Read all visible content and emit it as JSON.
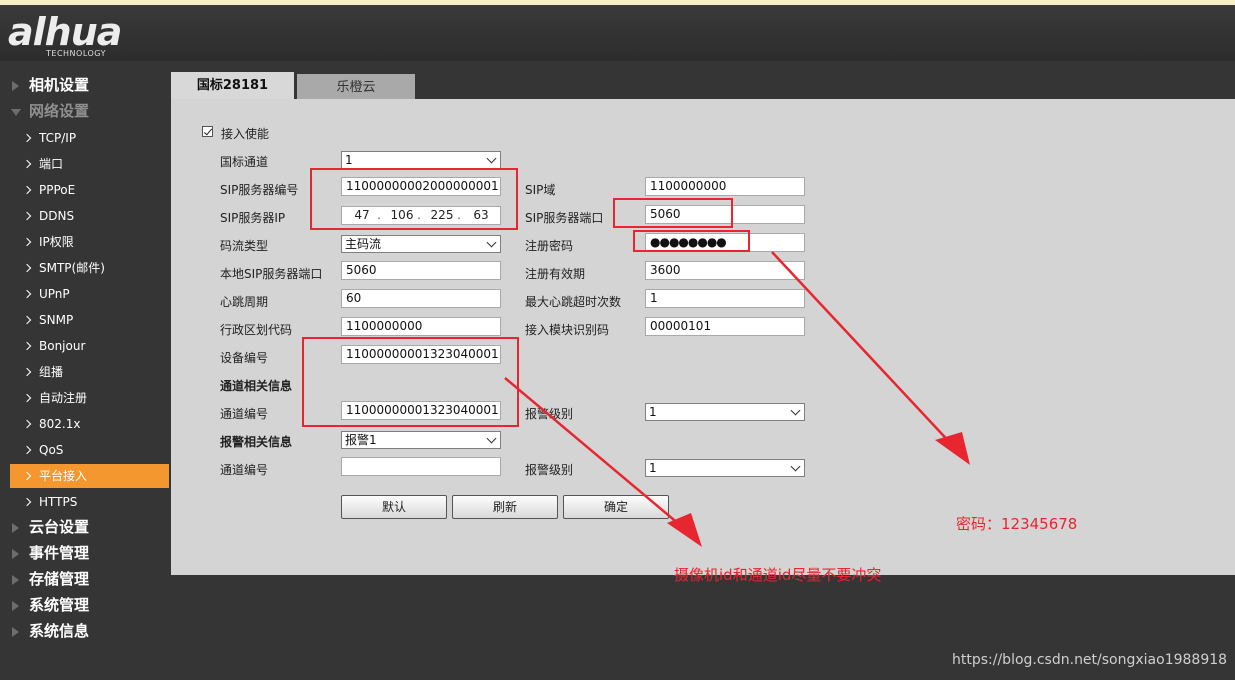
{
  "brand": {
    "logo_text": "alhua",
    "logo_sub": "TECHNOLOGY"
  },
  "sidebar": {
    "top_items": [
      {
        "label": "相机设置"
      },
      {
        "label": "网络设置"
      },
      {
        "label": "云台设置"
      },
      {
        "label": "事件管理"
      },
      {
        "label": "存储管理"
      },
      {
        "label": "系统管理"
      },
      {
        "label": "系统信息"
      }
    ],
    "sub_items": [
      {
        "label": "TCP/IP"
      },
      {
        "label": "端口"
      },
      {
        "label": "PPPoE"
      },
      {
        "label": "DDNS"
      },
      {
        "label": "IP权限"
      },
      {
        "label": "SMTP(邮件)"
      },
      {
        "label": "UPnP"
      },
      {
        "label": "SNMP"
      },
      {
        "label": "Bonjour"
      },
      {
        "label": "组播"
      },
      {
        "label": "自动注册"
      },
      {
        "label": "802.1x"
      },
      {
        "label": "QoS"
      },
      {
        "label": "平台接入"
      },
      {
        "label": "HTTPS"
      }
    ],
    "active_item": "平台接入"
  },
  "tabs": [
    {
      "label": "国标28181"
    },
    {
      "label": "乐橙云"
    }
  ],
  "form": {
    "enable_label": "接入使能",
    "enable_checked": true,
    "gb_channel": {
      "label": "国标通道",
      "value": "1"
    },
    "sip_server_id": {
      "label": "SIP服务器编号",
      "value": "11000000002000000001"
    },
    "sip_domain": {
      "label": "SIP域",
      "value": "1100000000"
    },
    "sip_server_ip": {
      "label": "SIP服务器IP",
      "octets": [
        "47",
        "106",
        "225",
        "63"
      ]
    },
    "sip_server_port": {
      "label": "SIP服务器端口",
      "value": "5060"
    },
    "stream_type": {
      "label": "码流类型",
      "value": "主码流"
    },
    "reg_password": {
      "label": "注册密码",
      "value": "●●●●●●●●"
    },
    "local_sip_port": {
      "label": "本地SIP服务器端口",
      "value": "5060"
    },
    "reg_validity": {
      "label": "注册有效期",
      "value": "3600"
    },
    "heartbeat": {
      "label": "心跳周期",
      "value": "60"
    },
    "max_heartbeat_timeout": {
      "label": "最大心跳超时次数",
      "value": "1"
    },
    "admin_region": {
      "label": "行政区划代码",
      "value": "1100000000"
    },
    "module_id": {
      "label": "接入模块识别码",
      "value": "00000101"
    },
    "device_id": {
      "label": "设备编号",
      "value": "11000000001323040001"
    },
    "channel_section": "通道相关信息",
    "channel_id": {
      "label": "通道编号",
      "value": "11000000001323040001"
    },
    "channel_alarm_level": {
      "label": "报警级别",
      "value": "1"
    },
    "alarm_section": "报警相关信息",
    "alarm_select": "报警1",
    "alarm_channel_id": {
      "label": "通道编号",
      "value": ""
    },
    "alarm_level": {
      "label": "报警级别",
      "value": "1"
    },
    "buttons": {
      "default": "默认",
      "refresh": "刷新",
      "ok": "确定"
    }
  },
  "annotations": {
    "password_note": "密码：12345678",
    "id_note": "摄像机id和通道id尽量不要冲突",
    "color": "#e8262f"
  },
  "watermark": "https://blog.csdn.net/songxiao1988918"
}
